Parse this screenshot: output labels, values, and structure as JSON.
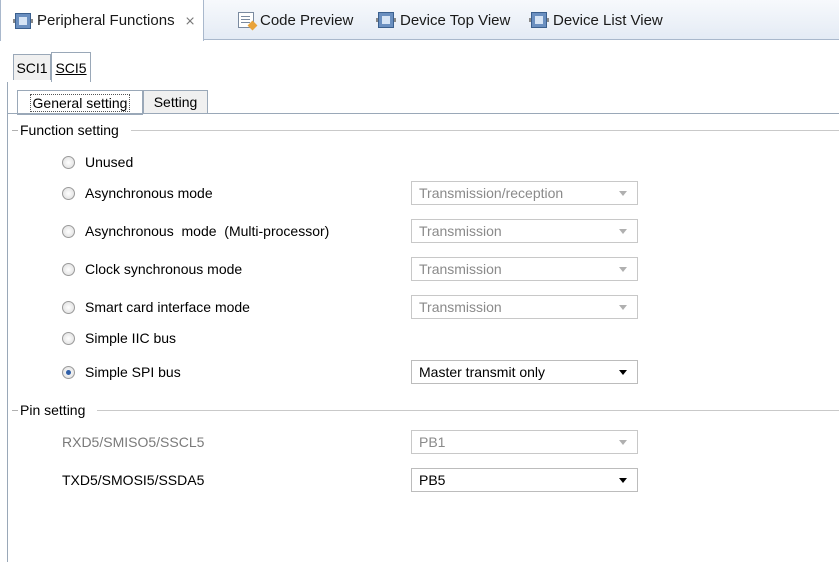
{
  "editor_tabs": [
    {
      "label": "Peripheral Functions",
      "close": "⨯",
      "icon": "chip-icon"
    },
    {
      "label": "Code Preview",
      "icon": "code-preview-icon"
    },
    {
      "label": "Device Top View",
      "icon": "chip-icon"
    },
    {
      "label": "Device List View",
      "icon": "chip-icon"
    }
  ],
  "sci_tabs": [
    "SCI1",
    "SCI5"
  ],
  "inner_tabs": [
    "General setting",
    "Setting"
  ],
  "function_setting": {
    "title": "Function setting",
    "options": [
      {
        "label": "Unused",
        "checked": false
      },
      {
        "label": "Asynchronous mode",
        "checked": false,
        "combo": "Transmission/reception"
      },
      {
        "label": "Asynchronous  mode  (Multi-processor)",
        "checked": false,
        "combo": "Transmission"
      },
      {
        "label": "Clock synchronous mode",
        "checked": false,
        "combo": "Transmission"
      },
      {
        "label": "Smart card interface mode",
        "checked": false,
        "combo": "Transmission"
      },
      {
        "label": "Simple IIC bus",
        "checked": false
      },
      {
        "label": "Simple SPI bus",
        "checked": true,
        "combo": "Master transmit only"
      }
    ]
  },
  "pin_setting": {
    "title": "Pin setting",
    "pins": [
      {
        "label": "RXD5/SMISO5/SSCL5",
        "value": "PB1",
        "enabled": false
      },
      {
        "label": "TXD5/SMOSI5/SSDA5",
        "value": "PB5",
        "enabled": true
      }
    ]
  },
  "colors": {
    "accent": "#2f5fa8",
    "tab_border": "#9aa8b8"
  }
}
